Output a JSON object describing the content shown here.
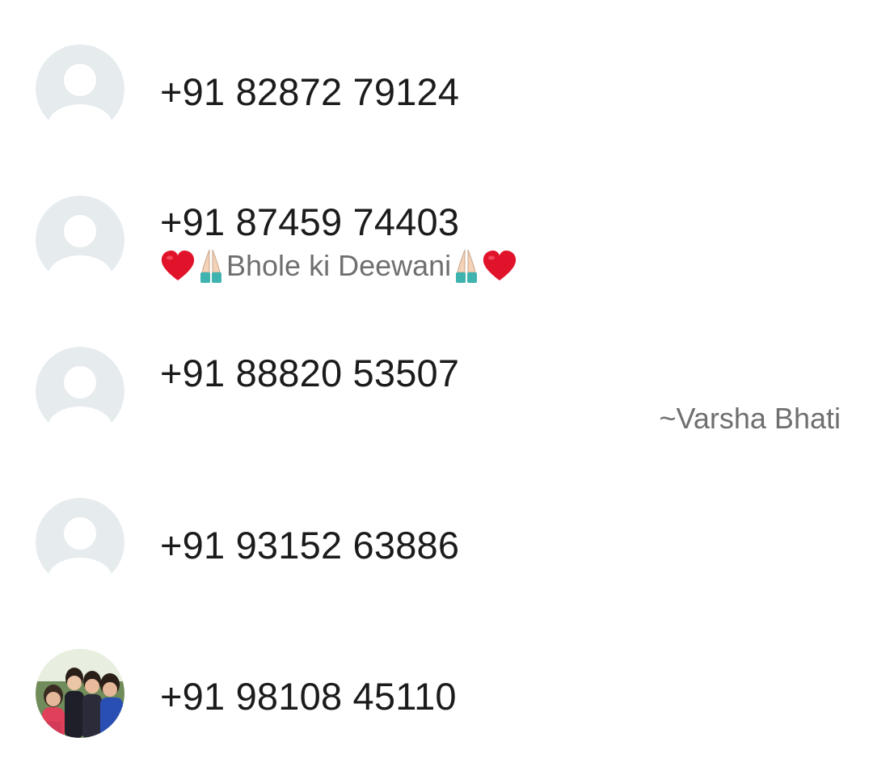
{
  "contacts": [
    {
      "phone": "+91 82872 79124",
      "avatar": "default-avatar"
    },
    {
      "phone": "+91 87459 74403",
      "avatar": "default-avatar",
      "about": {
        "prefix_icons": [
          "red-heart-icon",
          "folded-hands-icon"
        ],
        "text": "Bhole ki Deewani",
        "suffix_icons": [
          "folded-hands-icon",
          "red-heart-icon"
        ]
      }
    },
    {
      "phone": "+91 88820 53507",
      "avatar": "default-avatar",
      "push_name": "~Varsha Bhati"
    },
    {
      "phone": "+91 93152 63886",
      "avatar": "default-avatar"
    },
    {
      "phone": "+91 98108 45110",
      "avatar": "photo-avatar"
    }
  ],
  "colors": {
    "avatar_bg": "#e6ebee",
    "avatar_fg": "#ffffff",
    "primary_text": "#1b1b1b",
    "secondary_text": "#6f6f6f",
    "heart": "#e0132b"
  }
}
